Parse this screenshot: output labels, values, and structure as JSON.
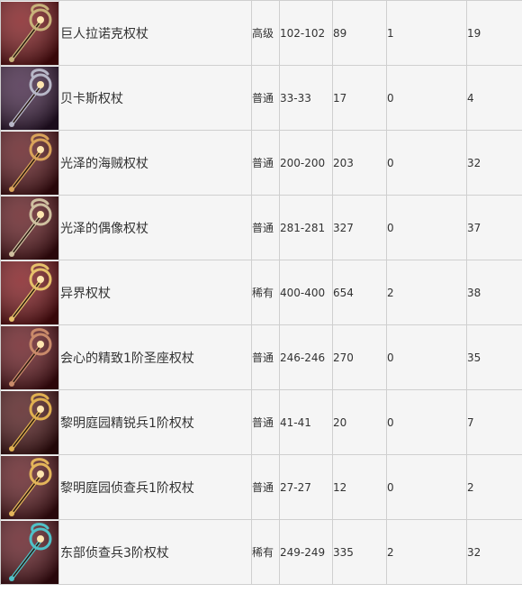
{
  "items": [
    {
      "name": "巨人拉诺克权杖",
      "quality": "高级",
      "damage": "102-102",
      "c4": "89",
      "c5": "1",
      "c6": "19",
      "icon": "staff-icon",
      "bg": "#7a1014",
      "accent": "#c8b27a"
    },
    {
      "name": "贝卡斯权杖",
      "quality": "普通",
      "damage": "33-33",
      "c4": "17",
      "c5": "0",
      "c6": "4",
      "icon": "staff-icon",
      "bg": "#3a1a3c",
      "accent": "#b7b7c7"
    },
    {
      "name": "光泽的海贼权杖",
      "quality": "普通",
      "damage": "200-200",
      "c4": "203",
      "c5": "0",
      "c6": "32",
      "icon": "staff-icon",
      "bg": "#5a1016",
      "accent": "#d9a35a"
    },
    {
      "name": "光泽的偶像权杖",
      "quality": "普通",
      "damage": "281-281",
      "c4": "327",
      "c5": "0",
      "c6": "37",
      "icon": "staff-icon",
      "bg": "#5b1016",
      "accent": "#cfc0a0"
    },
    {
      "name": "异界权杖",
      "quality": "稀有",
      "damage": "400-400",
      "c4": "654",
      "c5": "2",
      "c6": "38",
      "icon": "staff-icon",
      "bg": "#7a0f14",
      "accent": "#e6c06a"
    },
    {
      "name": "会心的精致1阶圣座权杖",
      "quality": "普通",
      "damage": "246-246",
      "c4": "270",
      "c5": "0",
      "c6": "35",
      "icon": "staff-icon",
      "bg": "#621017",
      "accent": "#c98a6a"
    },
    {
      "name": "黎明庭园精锐兵1阶权杖",
      "quality": "普通",
      "damage": "41-41",
      "c4": "20",
      "c5": "0",
      "c6": "7",
      "icon": "staff-icon",
      "bg": "#4b1012",
      "accent": "#e0b050"
    },
    {
      "name": "黎明庭园侦查兵1阶权杖",
      "quality": "普通",
      "damage": "27-27",
      "c4": "12",
      "c5": "0",
      "c6": "2",
      "icon": "staff-icon",
      "bg": "#5a1218",
      "accent": "#e3b55a"
    },
    {
      "name": "东部侦查兵3阶权杖",
      "quality": "稀有",
      "damage": "249-249",
      "c4": "335",
      "c5": "2",
      "c6": "32",
      "icon": "staff-icon",
      "bg": "#5a1018",
      "accent": "#4fc1c7"
    }
  ]
}
